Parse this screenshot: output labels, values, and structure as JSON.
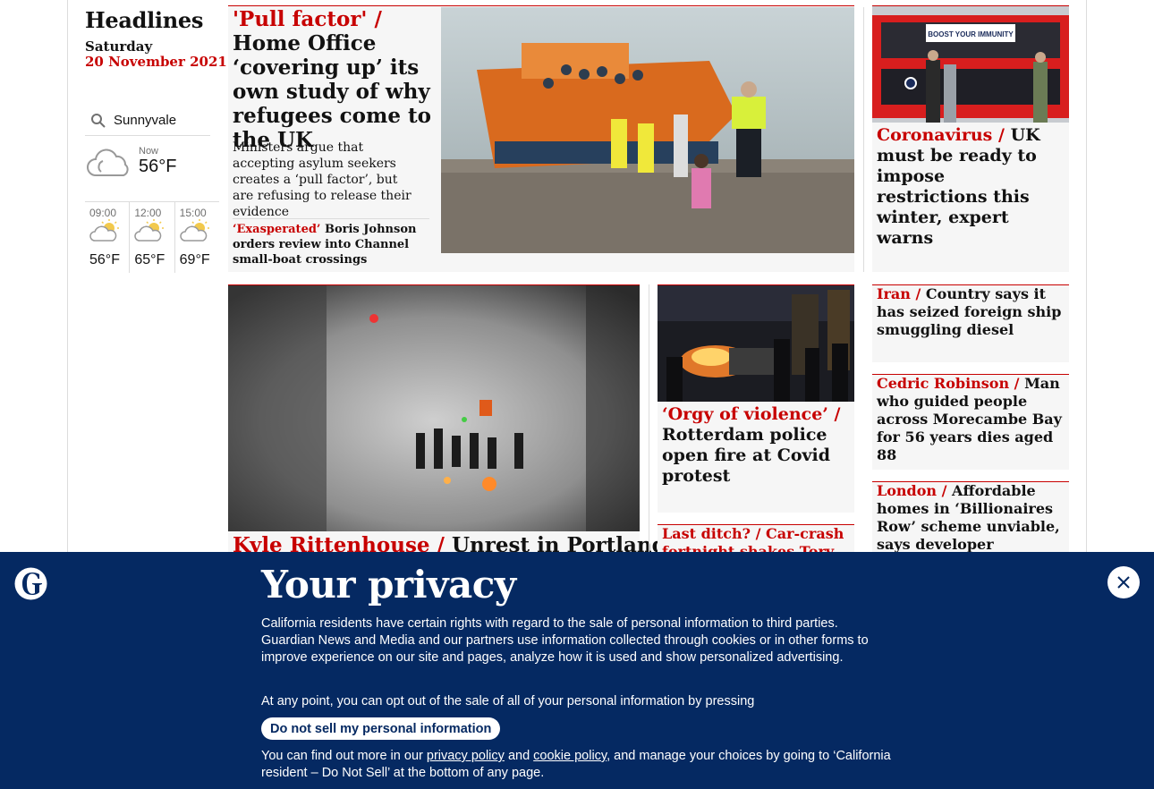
{
  "section": {
    "title": "Headlines",
    "day": "Saturday",
    "date": "20 November 2021"
  },
  "weather": {
    "location": "Sunnyvale",
    "now_label": "Now",
    "now_temp": "56°F",
    "now_icon": "cloudy-icon",
    "forecast": [
      {
        "time": "09:00",
        "temp": "56°F",
        "icon": "partly-cloudy-icon"
      },
      {
        "time": "12:00",
        "temp": "65°F",
        "icon": "partly-cloudy-icon"
      },
      {
        "time": "15:00",
        "temp": "69°F",
        "icon": "partly-cloudy-icon"
      }
    ]
  },
  "main_story": {
    "kicker": "'Pull factor' /",
    "headline": "Home Office ‘covering up’ its own study of why refugees come to the UK",
    "standfirst": "Ministers argue that accepting asylum seekers creates a ‘pull factor’, but are refusing to release their evidence",
    "sublink_kicker": "‘Exasperated’",
    "sublink_text": "Boris Johnson orders review into Channel small-boat crossings"
  },
  "right_top": {
    "kicker": "Coronavirus /",
    "headline": "UK must be ready to impose restrictions this winter, expert warns",
    "bus_ad_text": "BOOST YOUR IMMUNITY"
  },
  "big_story": {
    "kicker": "Kyle Rittenhouse /",
    "headline": "Unrest in Portland as"
  },
  "mid_story": {
    "kicker": "‘Orgy of violence’ /",
    "headline": "Rotterdam police open fire at Covid protest"
  },
  "mid_story2": {
    "kicker": "Last ditch? /",
    "headline": "Car-crash fortnight shakes Tory faith"
  },
  "right_list": [
    {
      "kicker": "Iran /",
      "headline": "Country says it has seized foreign ship smuggling diesel"
    },
    {
      "kicker": "Cedric Robinson /",
      "headline": "Man who guided people across Morecambe Bay for 56 years dies aged 88"
    },
    {
      "kicker": "London /",
      "headline": "Affordable homes in ‘Billionaires Row’ scheme unviable, says developer"
    }
  ],
  "privacy": {
    "title": "Your privacy",
    "paragraph1": "California residents have certain rights with regard to the sale of personal information to third parties. Guardian News and Media and our partners use information collected through cookies or in other forms to improve experience on our site and pages, analyze how it is used and show personalized advertising.",
    "paragraph2": "At any point, you can opt out of the sale of all of your personal information by pressing",
    "button": "Do not sell my personal information",
    "p3_start": "You can find out more in our",
    "privacy_link": "privacy policy",
    "p3_and": "and",
    "cookie_link": "cookie policy",
    "p3_end": ", and manage your choices by going to ‘California resident – Do Not Sell’ at the bottom of any page."
  },
  "colors": {
    "accent": "#c70000",
    "banner": "#052962"
  }
}
